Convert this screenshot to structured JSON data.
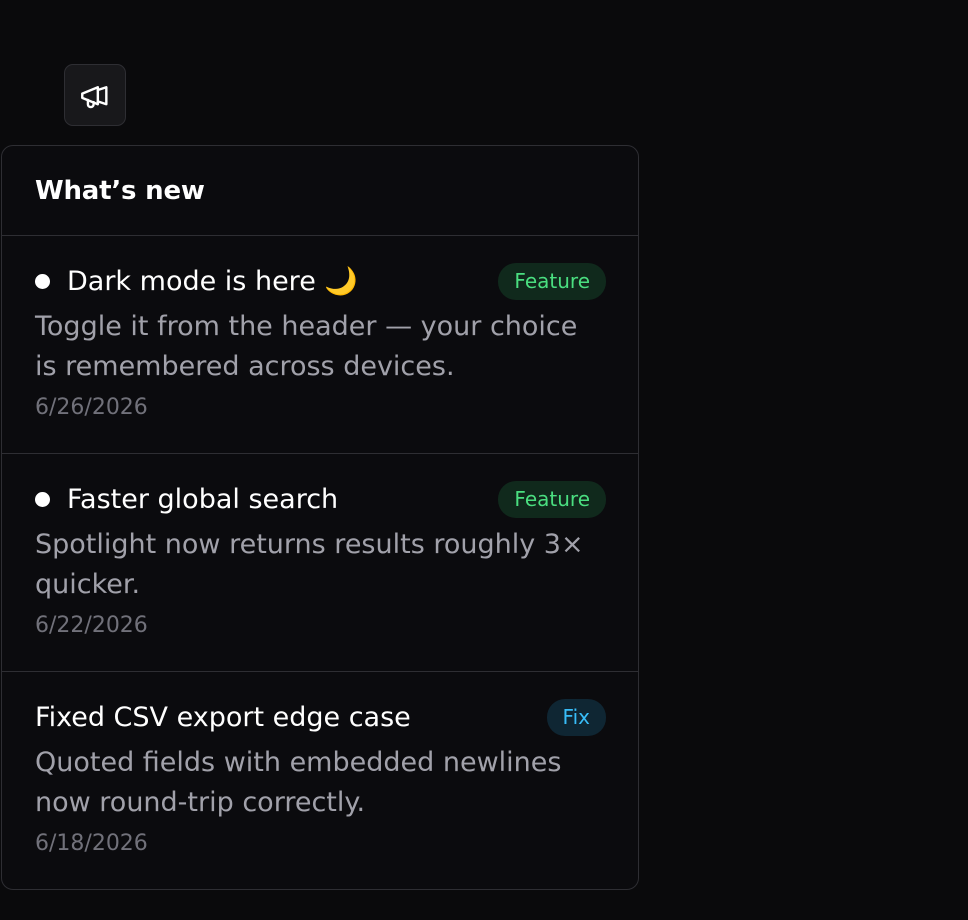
{
  "announce_button": {
    "icon": "megaphone-icon"
  },
  "panel": {
    "title": "What’s new",
    "items": [
      {
        "title": "Dark mode is here 🌙",
        "badge": "Feature",
        "description": "Toggle it from the header — your choice is remembered across devices.",
        "date": "6/26/2026",
        "unread": true
      },
      {
        "title": "Faster global search",
        "badge": "Feature",
        "description": "Spotlight now returns results roughly 3× quicker.",
        "date": "6/22/2026",
        "unread": true
      },
      {
        "title": "Fixed CSV export edge case",
        "badge": "Fix",
        "description": "Quoted fields with embedded newlines now round-trip correctly.",
        "date": "6/18/2026",
        "unread": false
      }
    ]
  },
  "colors": {
    "background": "#0a0a0c",
    "feature_badge_text": "#4ade80",
    "fix_badge_text": "#38bdf8"
  }
}
